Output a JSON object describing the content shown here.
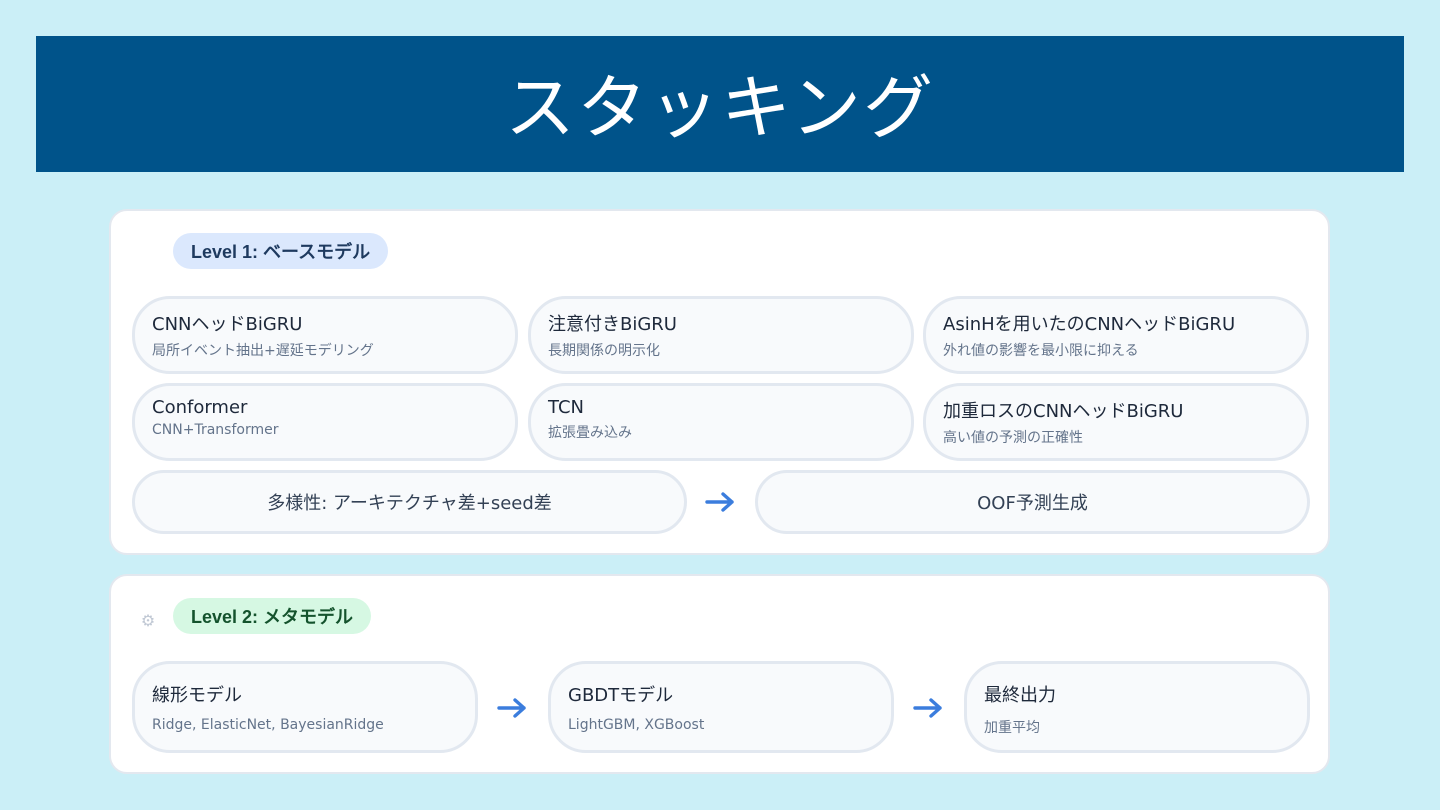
{
  "title": "スタッキング",
  "level1": {
    "badge": "Level 1: ベースモデル",
    "models": [
      {
        "name": "CNNヘッドBiGRU",
        "desc": "局所イベント抽出+遅延モデリング"
      },
      {
        "name": "注意付きBiGRU",
        "desc": "長期関係の明示化"
      },
      {
        "name": "AsinHを用いたのCNNヘッドBiGRU",
        "desc": "外れ値の影響を最小限に抑える"
      },
      {
        "name": "Conformer",
        "desc": "CNN+Transformer"
      },
      {
        "name": "TCN",
        "desc": "拡張畳み込み"
      },
      {
        "name": "加重ロスのCNNヘッドBiGRU",
        "desc": "高い値の予測の正確性"
      }
    ],
    "diversity": "多様性: アーキテクチャ差+seed差",
    "oof": "OOF予測生成"
  },
  "level2": {
    "badge": "Level 2: メタモデル",
    "steps": [
      {
        "name": "線形モデル",
        "desc": "Ridge, ElasticNet, BayesianRidge"
      },
      {
        "name": "GBDTモデル",
        "desc": "LightGBM, XGBoost"
      },
      {
        "name": "最終出力",
        "desc": "加重平均"
      }
    ]
  },
  "colors": {
    "background": "#cbeff7",
    "banner": "#00538a",
    "arrow": "#3b7ddd",
    "badge1": "#dbe8fd",
    "badge2": "#d6f8e3"
  },
  "icons": {
    "level2": "gear-icon",
    "flow": "arrow-right-icon"
  }
}
